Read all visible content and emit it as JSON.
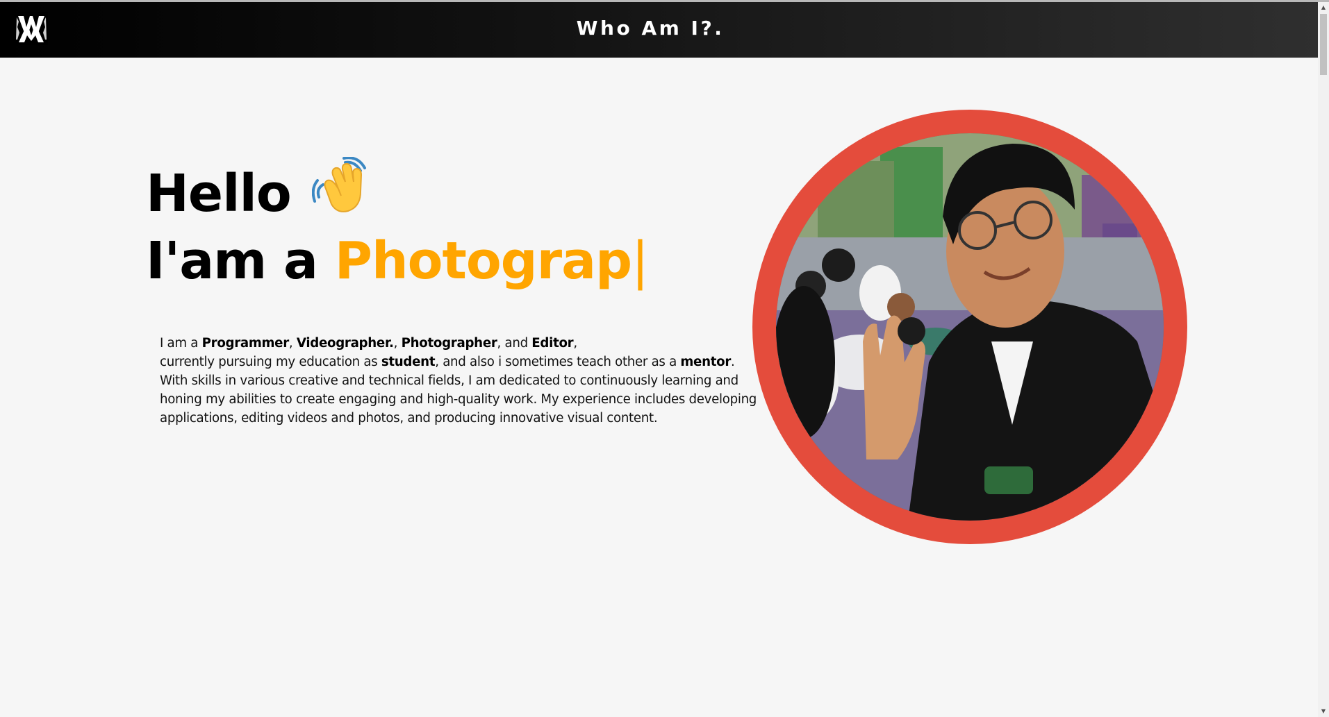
{
  "header": {
    "logo_alt": "WA logo",
    "title": "Who Am I?."
  },
  "hero": {
    "greeting": "Hello",
    "wave_icon": "waving-hand-icon",
    "role_prefix": "I'am a ",
    "role_typed": "Photograp",
    "cursor": "|"
  },
  "intro": {
    "p1": "I am a ",
    "role1": "Programmer",
    "sep1": ", ",
    "role2": "Videographer.",
    "sep2": ", ",
    "role3": "Photographer",
    "sep3": ", and ",
    "role4": "Editor",
    "p2": ",",
    "p3": "currently pursuing my education as ",
    "student": "student",
    "p4": ", and also i sometimes teach other as a ",
    "mentor": "mentor",
    "p5": ".",
    "p6": "With skills in various creative and technical fields, I am dedicated to continuously learning and honing my abilities to create engaging and high-quality work. My experience includes developing applications, editing videos and photos, and producing innovative visual content."
  },
  "colors": {
    "accent": "#ffa500",
    "ring": "#e44c3c",
    "navbar": "#000000",
    "background": "#f6f6f6"
  }
}
